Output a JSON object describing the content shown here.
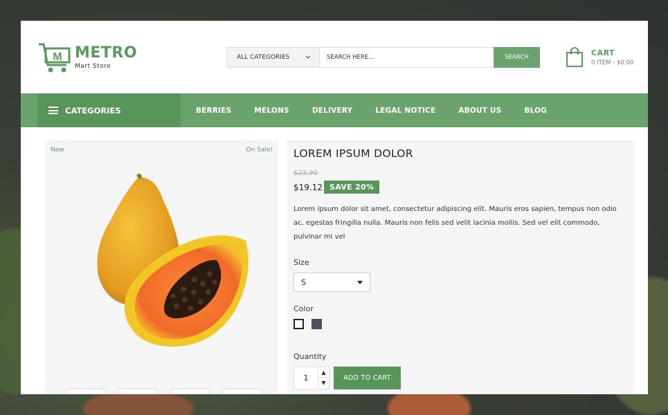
{
  "brand": {
    "name": "METRO",
    "tagline": "Mart Store",
    "logo_letter": "M"
  },
  "search": {
    "category": "ALL CATEGORIES",
    "placeholder": "SEARCH HERE...",
    "button": "SEARCH"
  },
  "cart": {
    "title": "CART",
    "summary": "0 ITEM - $0.00"
  },
  "nav": {
    "categories_label": "CATEGORIES",
    "links": [
      "BERRIES",
      "MELONS",
      "DELIVERY",
      "LEGAL NOTICE",
      "ABOUT US",
      "BLOG"
    ]
  },
  "gallery": {
    "badge_new": "New",
    "badge_sale": "On Sale!"
  },
  "product": {
    "title": "LOREM IPSUM DOLOR",
    "old_price": "$23.90",
    "price": "$19.12",
    "save_badge": "SAVE 20%",
    "description": "Lorem ipsum dolor sit amet, consectetur adipiscing elit. Mauris eros sapien, tempus non odio ac, egestas fringilla nulla. Mauris non felis sed velit lacinia mollis. Sed vel elit commodo, pulvinar mi vel",
    "size_label": "Size",
    "size_value": "S",
    "color_label": "Color",
    "colors": [
      "#ffffff",
      "#4a5260"
    ],
    "quantity_label": "Quantity",
    "quantity": "1",
    "add_to_cart": "ADD TO CART"
  },
  "theme": {
    "accent": "#6aa36e",
    "accent_dark": "#57955b"
  }
}
